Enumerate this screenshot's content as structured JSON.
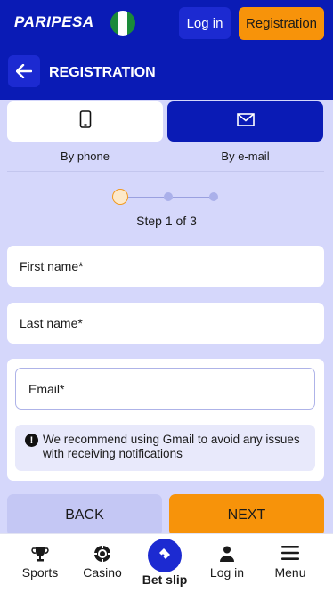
{
  "app": {
    "logo_text": "PARIPESA"
  },
  "topbar": {
    "flag_colors": [
      "#1a8a3a",
      "#ffffff",
      "#1a8a3a"
    ],
    "login_label": "Log in",
    "registration_label": "Registration"
  },
  "header": {
    "title": "REGISTRATION",
    "back_icon": "arrow-left-icon"
  },
  "tabs": [
    {
      "label": "By phone",
      "icon": "phone-icon",
      "selected": false
    },
    {
      "label": "By e-mail",
      "icon": "envelope-icon",
      "selected": true
    }
  ],
  "stepper": {
    "current": 1,
    "total": 3,
    "text": "Step 1 of 3"
  },
  "form": {
    "first_name_placeholder": "First name*",
    "last_name_placeholder": "Last name*",
    "email_placeholder": "Email*",
    "notice": "We recommend using Gmail to avoid any issues with receiving notifications"
  },
  "actions": {
    "back_label": "BACK",
    "next_label": "NEXT"
  },
  "bottom_nav": [
    {
      "label": "Sports",
      "icon": "trophy-icon"
    },
    {
      "label": "Casino",
      "icon": "casino-chip-icon"
    },
    {
      "label": "Bet slip",
      "icon": "ticket-icon"
    },
    {
      "label": "Log in",
      "icon": "user-icon"
    },
    {
      "label": "Menu",
      "icon": "hamburger-icon"
    }
  ],
  "colors": {
    "primary": "#0a1bb5",
    "accent": "#f7930a",
    "background": "#d5d7fb"
  }
}
